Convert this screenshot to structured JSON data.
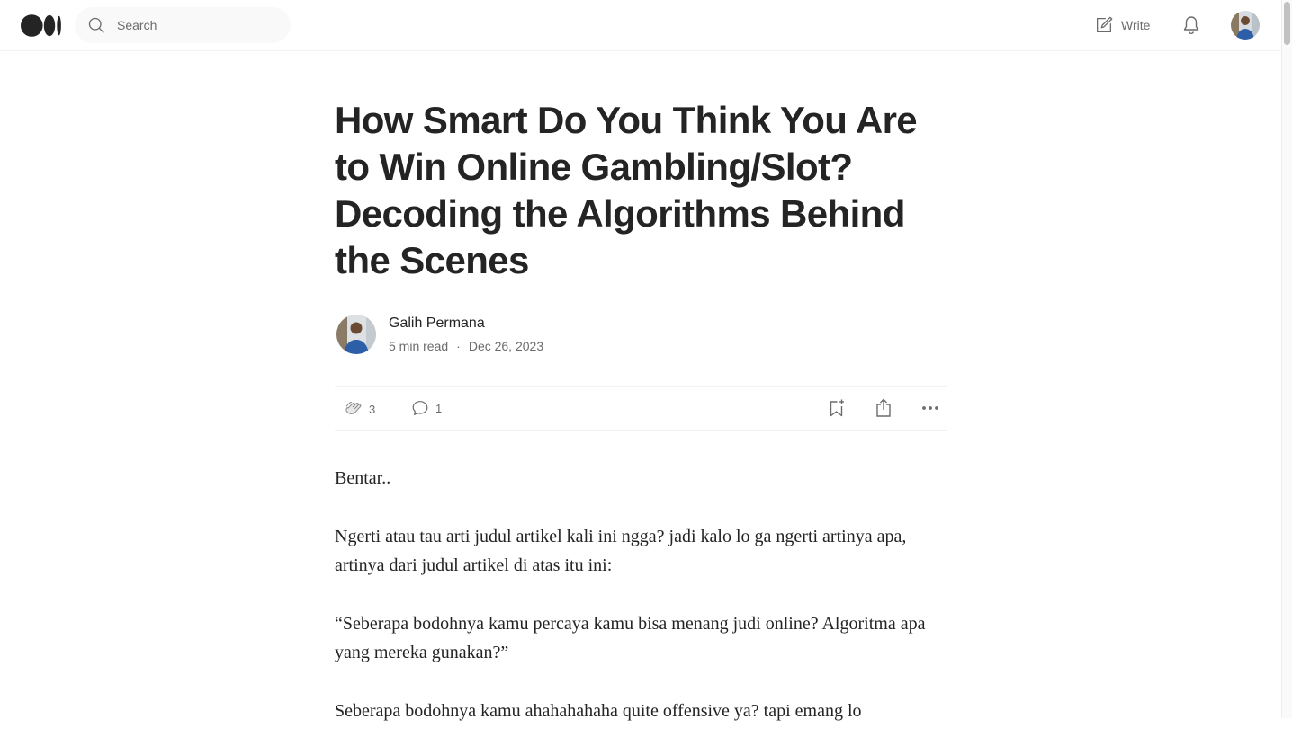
{
  "header": {
    "logo_icon": "medium-logo-icon",
    "search": {
      "placeholder": "Search",
      "icon": "search-icon"
    },
    "write_label": "Write",
    "write_icon": "write-icon",
    "notifications_icon": "bell-icon",
    "avatar": "user-avatar"
  },
  "article": {
    "title": "How Smart Do You Think You Are to Win Online Gambling/Slot? Decoding the Algorithms Behind the Scenes",
    "author": "Galih Permana",
    "read_time": "5 min read",
    "separator": "·",
    "date": "Dec 26, 2023",
    "claps": "3",
    "responses": "1",
    "paragraphs": [
      "Bentar..",
      "Ngerti atau tau arti judul artikel kali ini ngga? jadi kalo lo ga ngerti artinya apa, artinya dari judul artikel di atas itu ini:",
      "“Seberapa bodohnya kamu percaya kamu bisa menang judi online? Algoritma apa yang mereka gunakan?”",
      "Seberapa bodohnya kamu ahahahahaha quite offensive ya? tapi emang lo"
    ]
  },
  "colors": {
    "text": "#242424",
    "muted": "#6b6b6b",
    "divider": "#f2f2f2",
    "search_bg": "#f9f9f9"
  }
}
